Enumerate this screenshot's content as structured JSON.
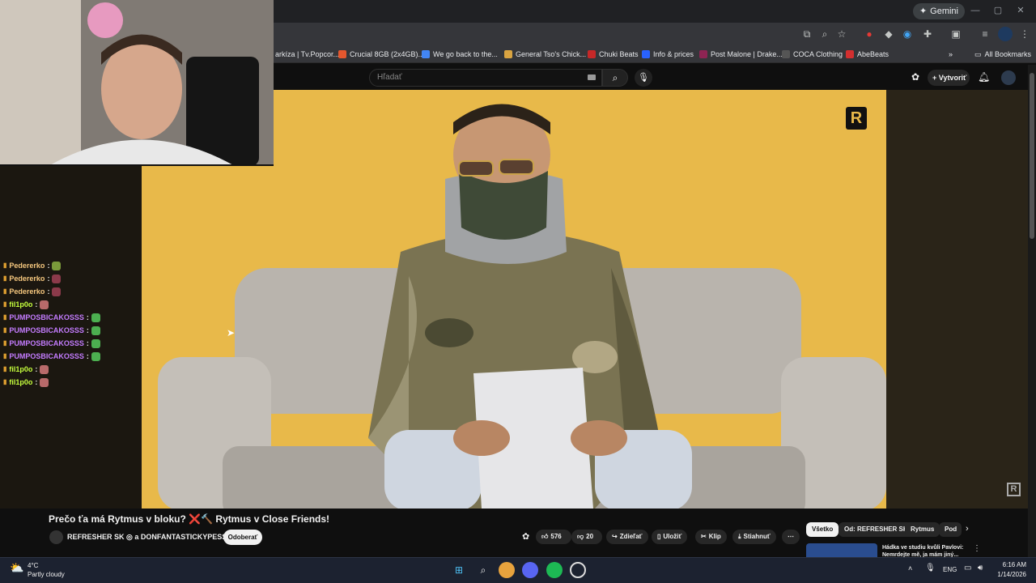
{
  "browser": {
    "gemini_label": "Gemini",
    "bookmarks": [
      {
        "label": "arkíza | Tv.Popcor...",
        "color": "#7a3cff"
      },
      {
        "label": "Crucial 8GB (2x4GB)...",
        "color": "#e4572e"
      },
      {
        "label": "We go back to the...",
        "color": "#4285f4",
        "icon_text": "G"
      },
      {
        "label": "General Tso's Chick...",
        "color": "#d9a441"
      },
      {
        "label": "Chuki Beats",
        "color": "#c62828"
      },
      {
        "label": "Info & prices",
        "color": "#2962ff",
        "icon_text": "B."
      },
      {
        "label": "Post Malone | Drake...",
        "color": "#8e2453"
      },
      {
        "label": "COCA Clothing",
        "color": "#222222"
      },
      {
        "label": "AbeBeats",
        "color": "#d32f2f"
      }
    ],
    "all_bookmarks": "All Bookmarks"
  },
  "youtube": {
    "search_placeholder": "Hľadať",
    "create_label": "Vytvoriť",
    "video_title": "Prečo ťa má Rytmus v bloku? ❌🔨 Rytmus v Close Friends!",
    "channel": "REFRESHER SK ◎ a DONFANTASTICKYPESS ◎",
    "subscribe": "Odoberať",
    "likes": "576",
    "dislikes": "20",
    "share": "Zdieľať",
    "save": "Uložiť",
    "clip": "Klip",
    "download": "Stiahnuť",
    "chips": [
      "Všetko",
      "Od: REFRESHER SK",
      "Rytmus",
      "Pod"
    ],
    "rec_title": "Hádka ve studiu kvůli Pavlovi: Nemrdejte mě, ja mám jiný..."
  },
  "chat": [
    {
      "user": "Pedererko",
      "color": "#f5c77e",
      "emote": "#7a9a3a"
    },
    {
      "user": "Pedererko",
      "color": "#f5c77e",
      "emote": "#8b3a4a"
    },
    {
      "user": "Pedererko",
      "color": "#f5c77e",
      "emote": "#8b3a4a"
    },
    {
      "user": "fil1p0o",
      "color": "#c6ff3d",
      "emote": "#b86a6a"
    },
    {
      "user": "PUMPOSBICAKOSSS",
      "color": "#c47cff",
      "emote": "#4caf50"
    },
    {
      "user": "PUMPOSBICAKOSSS",
      "color": "#c47cff",
      "emote": "#4caf50"
    },
    {
      "user": "PUMPOSBICAKOSSS",
      "color": "#c47cff",
      "emote": "#4caf50"
    },
    {
      "user": "PUMPOSBICAKOSSS",
      "color": "#c47cff",
      "emote": "#4caf50"
    },
    {
      "user": "fil1p0o",
      "color": "#c6ff3d",
      "emote": "#b86a6a"
    },
    {
      "user": "fil1p0o",
      "color": "#c6ff3d",
      "emote": "#b86a6a"
    }
  ],
  "taskbar": {
    "weather_temp": "4°C",
    "weather_desc": "Partly cloudy",
    "lang": "ENG",
    "time": "6:16 AM",
    "date": "1/14/2026"
  }
}
